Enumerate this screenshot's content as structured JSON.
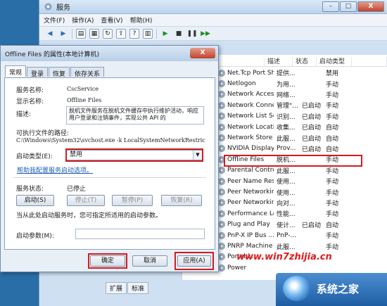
{
  "services_window": {
    "title": "服务",
    "menu": [
      "文件(F)",
      "操作(A)",
      "查看(V)",
      "帮助(H)"
    ],
    "columns": [
      "",
      "描述",
      "状态",
      "启动类型"
    ],
    "rows": [
      {
        "name": "Net.Tcp Port Sh...",
        "desc": "提供...",
        "status": "",
        "startup": "禁用"
      },
      {
        "name": "Netlogon",
        "desc": "为用...",
        "status": "",
        "startup": "手动"
      },
      {
        "name": "Network Access ...",
        "desc": "网络...",
        "status": "",
        "startup": "手动"
      },
      {
        "name": "Network Connec...",
        "desc": "管理\"...",
        "status": "已启动",
        "startup": "手动"
      },
      {
        "name": "Network List Ser...",
        "desc": "识别...",
        "status": "已启动",
        "startup": "手动"
      },
      {
        "name": "Network Locatio...",
        "desc": "收集...",
        "status": "已启动",
        "startup": "自动"
      },
      {
        "name": "Network Store I...",
        "desc": "此服...",
        "status": "已启动",
        "startup": "自动"
      },
      {
        "name": "NVIDIA Display ...",
        "desc": "Prov...",
        "status": "已启动",
        "startup": "自动"
      },
      {
        "name": "Offline Files",
        "desc": "脱机...",
        "status": "",
        "startup": "手动"
      },
      {
        "name": "Parental Controls",
        "desc": "此服...",
        "status": "",
        "startup": "手动"
      },
      {
        "name": "Peer Name Res...",
        "desc": "使用...",
        "status": "",
        "startup": "手动"
      },
      {
        "name": "Peer Networkin...",
        "desc": "使用...",
        "status": "",
        "startup": "手动"
      },
      {
        "name": "Peer Networkin...",
        "desc": "向对...",
        "status": "",
        "startup": "手动"
      },
      {
        "name": "Performance Lo...",
        "desc": "性能...",
        "status": "",
        "startup": "手动"
      },
      {
        "name": "Plug and Play",
        "desc": "使计...",
        "status": "已启动",
        "startup": "自动"
      },
      {
        "name": "PnP-X IP Bus ...",
        "desc": "PnP-...",
        "status": "",
        "startup": "手动"
      },
      {
        "name": "PNRP Machine ...",
        "desc": "此服...",
        "status": "",
        "startup": "手动"
      },
      {
        "name": "Portabl...",
        "desc": "",
        "status": "",
        "startup": ""
      },
      {
        "name": "Power",
        "desc": "",
        "status": "",
        "startup": ""
      }
    ],
    "bottom_tabs": [
      "扩展",
      "标准"
    ]
  },
  "dialog": {
    "title": "Offline Files 的属性(本地计算机)",
    "tabs": [
      "常规",
      "登录",
      "恢复",
      "依存关系"
    ],
    "service_name_label": "服务名称:",
    "service_name": "CscService",
    "display_name_label": "显示名称:",
    "display_name": "Offline Files",
    "description_label": "描述:",
    "description": "脱机文件服务在脱机文件缓存中执行维护活动，响应用户登录和注销事件，实现公共 API 的",
    "exe_path_label": "可执行文件的路径:",
    "exe_path": "C:\\Windows\\System32\\svchost.exe -k LocalSystemNetworkRestric",
    "startup_type_label": "启动类型(E):",
    "startup_type": "禁用",
    "help_link": "帮助我配置服务启动选项。",
    "service_status_label": "服务状态:",
    "service_status": "已停止",
    "start_btn": "启动(S)",
    "stop_btn": "停止(T)",
    "pause_btn": "暂停(P)",
    "resume_btn": "恢复(R)",
    "hint": "当从此处启动服务时，您可指定所适用的启动参数。",
    "start_params_label": "启动参数(M):",
    "ok": "确定",
    "cancel": "取消",
    "apply": "应用(A)",
    "close": "X"
  },
  "watermark": {
    "url": "www.win7zhijia.cn",
    "brand": "系统之家"
  }
}
